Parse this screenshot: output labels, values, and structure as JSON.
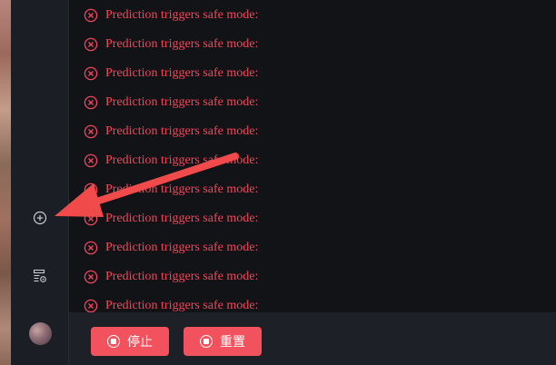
{
  "log": {
    "lines": [
      "Prediction triggers safe mode:",
      "Prediction triggers safe mode:",
      "Prediction triggers safe mode:",
      "Prediction triggers safe mode:",
      "Prediction triggers safe mode:",
      "Prediction triggers safe mode:",
      "Prediction triggers safe mode:",
      "Prediction triggers safe mode:",
      "Prediction triggers safe mode:",
      "Prediction triggers safe mode:",
      "Prediction triggers safe mode:"
    ],
    "status_icon": "error-circle-icon",
    "error_color": "#f2475a"
  },
  "sidebar": {
    "icons": [
      "add-circle-icon",
      "settings-list-icon",
      "avatar"
    ]
  },
  "footer": {
    "stop_label": "停止",
    "reset_label": "重置",
    "button_color": "#f1525d"
  },
  "annotation": {
    "arrow_color": "#f04a4a"
  }
}
